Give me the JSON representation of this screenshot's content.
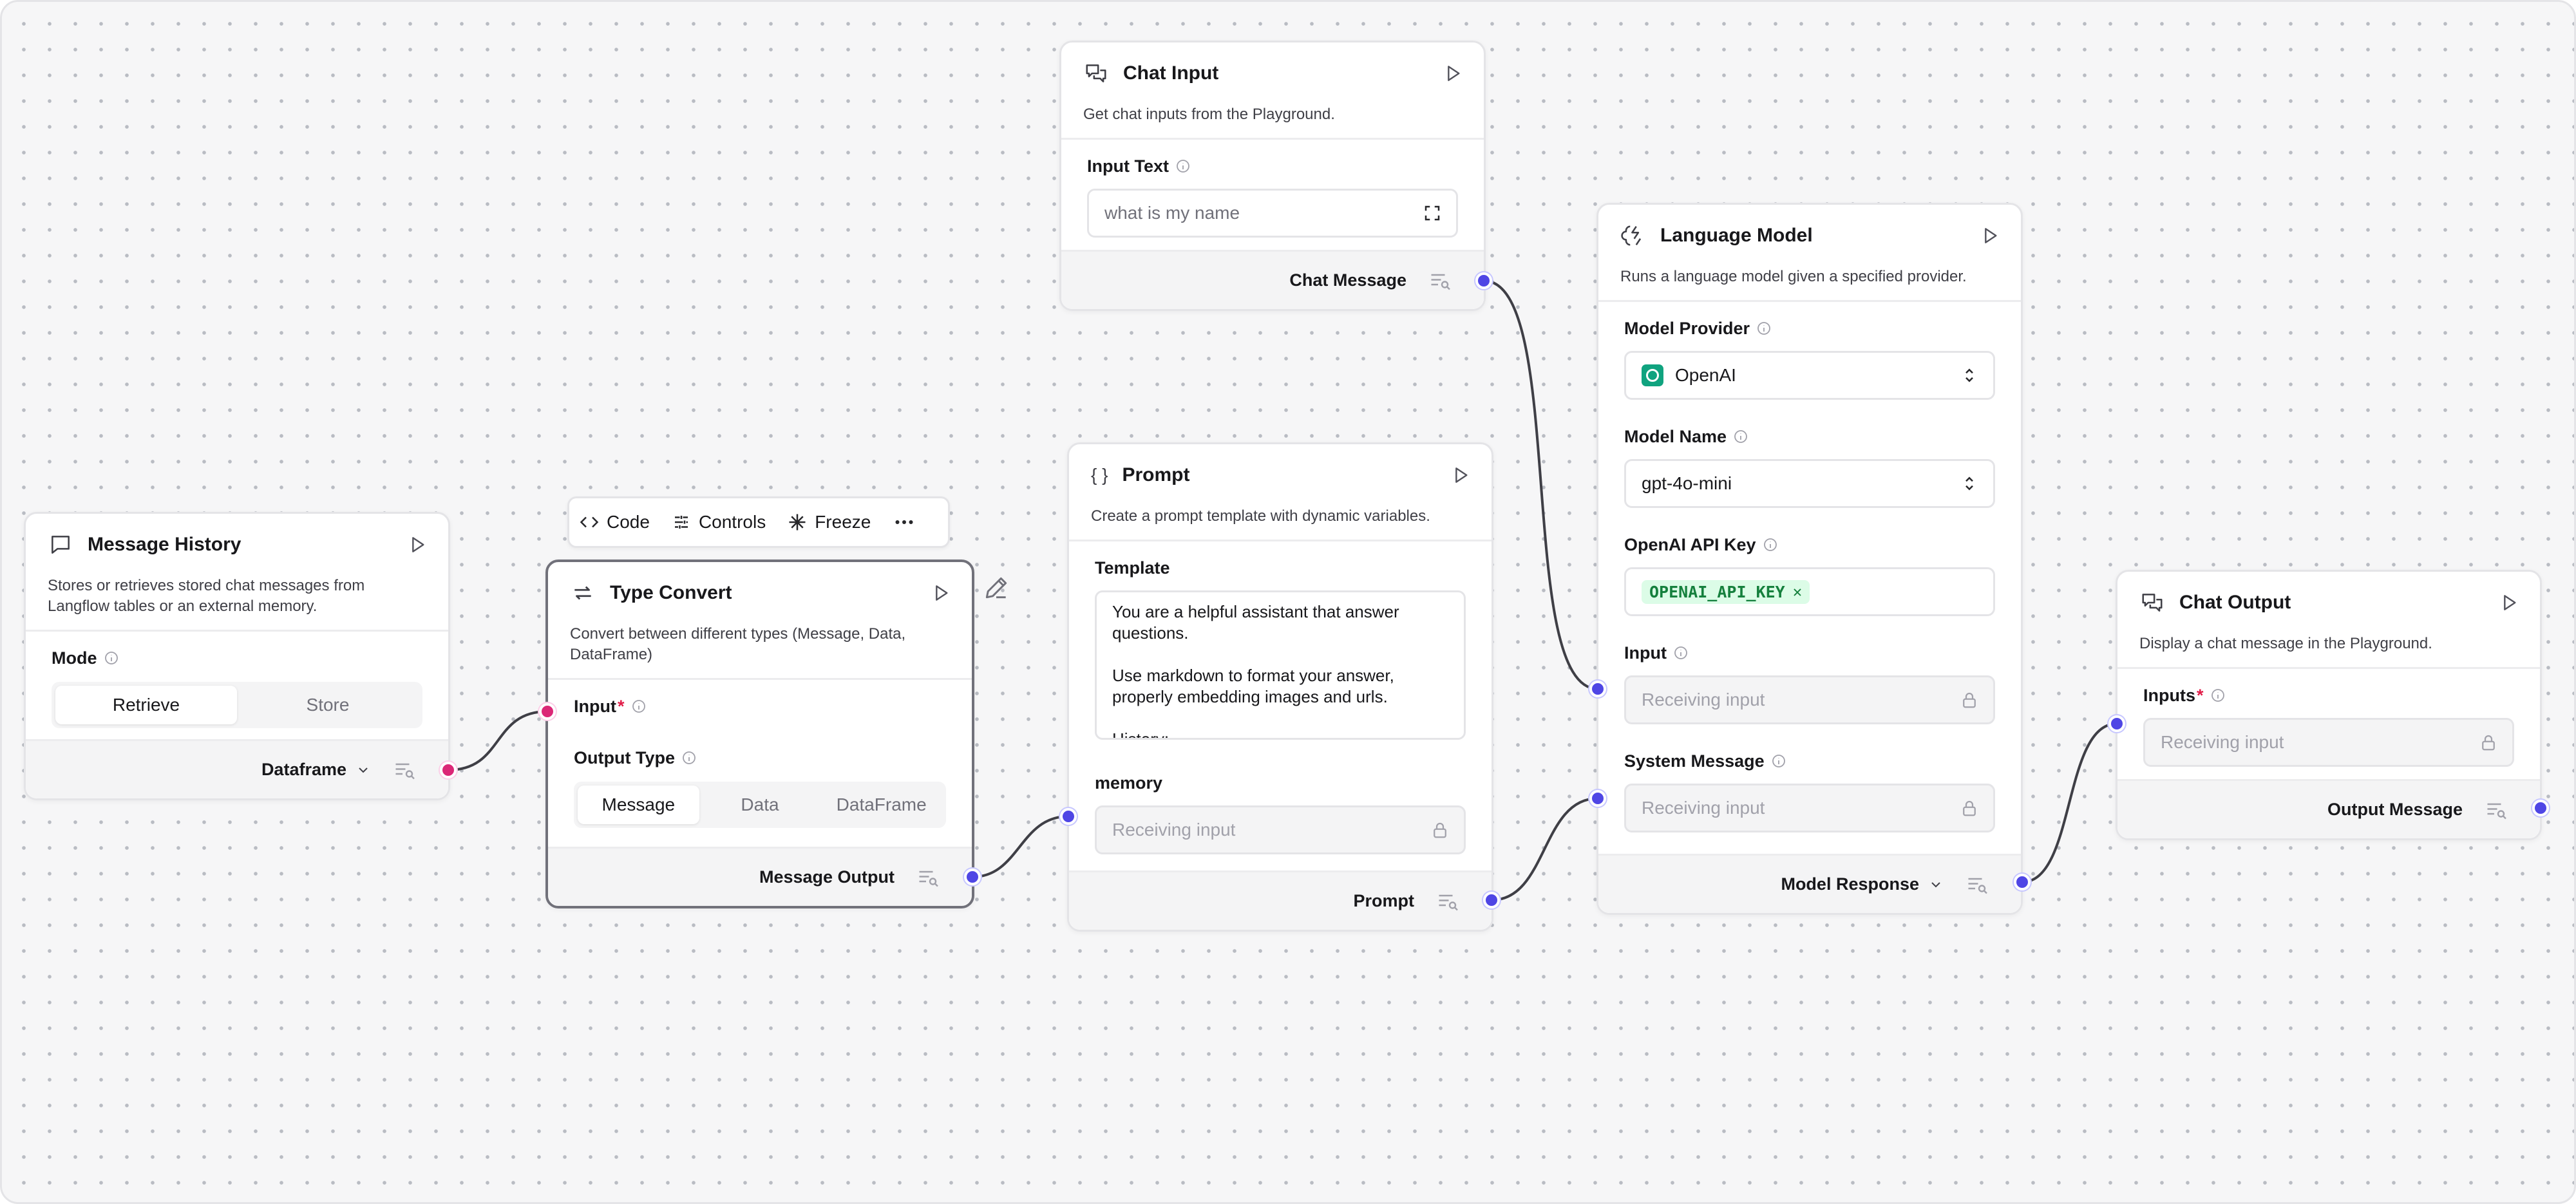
{
  "nodes": {
    "chat_input": {
      "title": "Chat Input",
      "description": "Get chat inputs from the Playground.",
      "field_label": "Input Text",
      "input_value": "what is my name",
      "output_label": "Chat Message"
    },
    "message_history": {
      "title": "Message History",
      "description": "Stores or retrieves stored chat messages from Langflow tables or an external memory.",
      "field_label": "Mode",
      "options": [
        "Retrieve",
        "Store"
      ],
      "selected": "Retrieve",
      "output_label": "Dataframe"
    },
    "type_convert": {
      "title": "Type Convert",
      "description": "Convert between different types (Message, Data, DataFrame)",
      "input_label": "Input",
      "input_required": "*",
      "output_type_label": "Output Type",
      "options": [
        "Message",
        "Data",
        "DataFrame"
      ],
      "selected": "Message",
      "output_label": "Message Output"
    },
    "prompt": {
      "title": "Prompt",
      "icon_text": "{ }",
      "description": "Create a prompt template with dynamic variables.",
      "template_label": "Template",
      "template_text": "You are a helpful assistant that answer questions.\n\nUse markdown to format your answer, properly embedding images and urls.\n\nHistory:",
      "memory_label": "memory",
      "memory_placeholder": "Receiving input",
      "output_label": "Prompt"
    },
    "language_model": {
      "title": "Language Model",
      "description": "Runs a language model given a specified provider.",
      "provider_label": "Model Provider",
      "provider_value": "OpenAI",
      "model_name_label": "Model Name",
      "model_name_value": "gpt-4o-mini",
      "api_key_label": "OpenAI API Key",
      "api_key_tag": "OPENAI_API_KEY",
      "input_label": "Input",
      "input_placeholder": "Receiving input",
      "system_label": "System Message",
      "system_placeholder": "Receiving input",
      "output_label": "Model Response"
    },
    "chat_output": {
      "title": "Chat Output",
      "description": "Display a chat message in the Playground.",
      "inputs_label": "Inputs",
      "inputs_required": "*",
      "inputs_placeholder": "Receiving input",
      "output_label": "Output Message"
    }
  },
  "toolbar": {
    "code": "Code",
    "controls": "Controls",
    "freeze": "Freeze"
  },
  "colors": {
    "handle_message": "#4f46e5",
    "handle_dataframe": "#db2777",
    "edge": "#3f3f46"
  }
}
